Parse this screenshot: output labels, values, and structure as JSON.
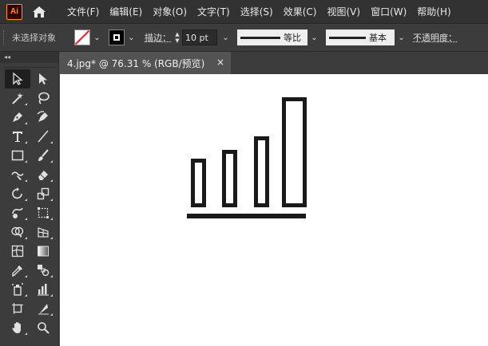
{
  "app": {
    "logo_text": "Ai",
    "home_icon": "home-icon"
  },
  "menu": [
    "文件(F)",
    "编辑(E)",
    "对象(O)",
    "文字(T)",
    "选择(S)",
    "效果(C)",
    "视图(V)",
    "窗口(W)",
    "帮助(H)"
  ],
  "control_bar": {
    "selection_state": "未选择对象",
    "stroke_label": "描边：",
    "stroke_weight": "10 pt",
    "profile_label": "等比",
    "brush_label": "基本",
    "opacity_label": "不透明度："
  },
  "colors": {
    "accent": "#ff9a00",
    "fill_none_slash": "#e8262a",
    "artwork": "#1a1a1a"
  },
  "tab": {
    "title": "4.jpg* @ 76.31 % (RGB/预览)",
    "close": "×"
  },
  "toolbar": {
    "collapse": "◂◂",
    "tools": [
      "selection-tool-icon",
      "direct-selection-tool-icon",
      "magic-wand-tool-icon",
      "lasso-tool-icon",
      "pen-tool-icon",
      "curvature-tool-icon",
      "type-tool-icon",
      "line-segment-tool-icon",
      "rectangle-tool-icon",
      "paintbrush-tool-icon",
      "shaper-tool-icon",
      "eraser-tool-icon",
      "rotate-tool-icon",
      "scale-tool-icon",
      "warp-tool-icon",
      "free-transform-tool-icon",
      "shape-builder-tool-icon",
      "perspective-grid-tool-icon",
      "mesh-tool-icon",
      "gradient-tool-icon",
      "eyedropper-tool-icon",
      "blend-tool-icon",
      "symbol-sprayer-tool-icon",
      "column-graph-tool-icon",
      "artboard-tool-icon",
      "slice-tool-icon",
      "hand-tool-icon",
      "zoom-tool-icon"
    ]
  }
}
